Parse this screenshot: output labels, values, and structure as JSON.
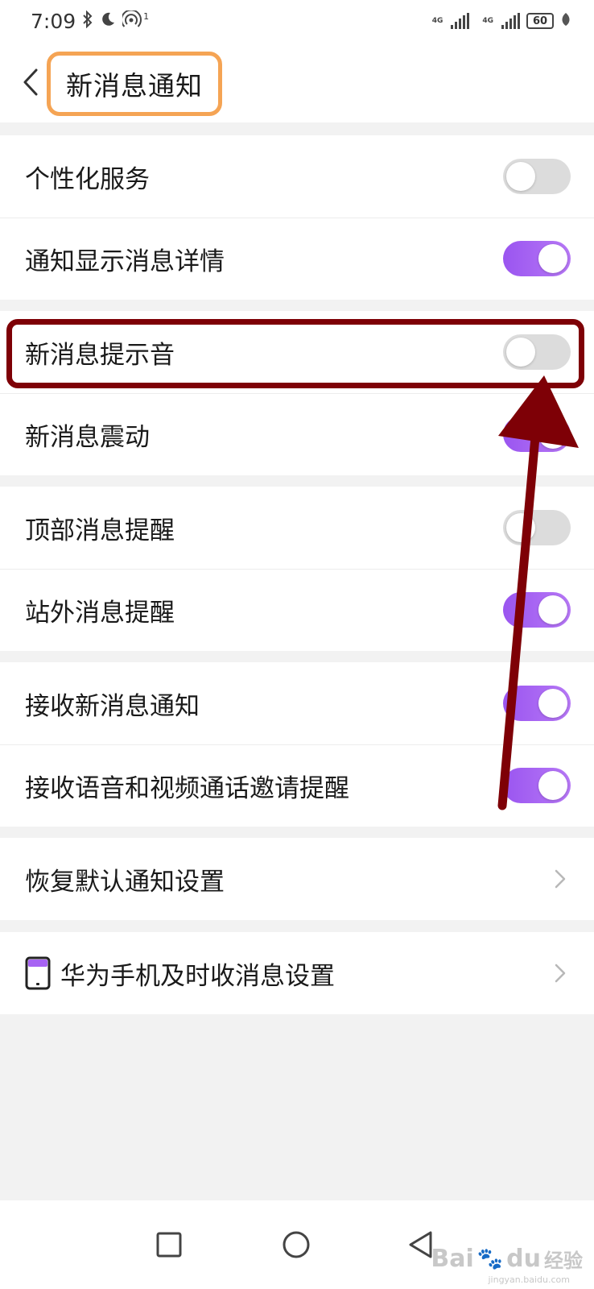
{
  "status_bar": {
    "time": "7:09",
    "icons": [
      "bluetooth-icon",
      "moon-icon",
      "hotspot-icon"
    ],
    "hotspot_count": "1",
    "network1": "4G",
    "network2": "4G",
    "battery": "60"
  },
  "header": {
    "title": "新消息通知",
    "back_icon": "chevron-left-icon"
  },
  "sections": {
    "s1": [
      {
        "label": "个性化服务",
        "on": false
      },
      {
        "label": "通知显示消息详情",
        "on": true
      }
    ],
    "s2": [
      {
        "label": "新消息提示音",
        "on": false
      },
      {
        "label": "新消息震动",
        "on": true
      }
    ],
    "s3": [
      {
        "label": "顶部消息提醒",
        "on": false
      },
      {
        "label": "站外消息提醒",
        "on": true
      }
    ],
    "s4": [
      {
        "label": "接收新消息通知",
        "on": true
      },
      {
        "label": "接收语音和视频通话邀请提醒",
        "on": true
      }
    ],
    "s5": [
      {
        "label": "恢复默认通知设置",
        "icon": "chevron-right-icon"
      }
    ],
    "s6": [
      {
        "label": "华为手机及时收消息设置",
        "icon": "phone-icon"
      }
    ]
  },
  "annotation": {
    "highlight_color": "#7e0006",
    "title_highlight_color": "#f5a454"
  },
  "colors": {
    "toggle_on": "#a763f3",
    "toggle_off": "#dcdcdc",
    "background": "#f2f2f2"
  },
  "nav_bar": {
    "buttons": [
      "recent-apps-icon",
      "home-icon",
      "back-triangle-icon"
    ]
  },
  "watermark": {
    "text": "Bai",
    "paw": "🐾",
    "du": "du",
    "cn": "经验",
    "sub": "jingyan.baidu.com"
  }
}
